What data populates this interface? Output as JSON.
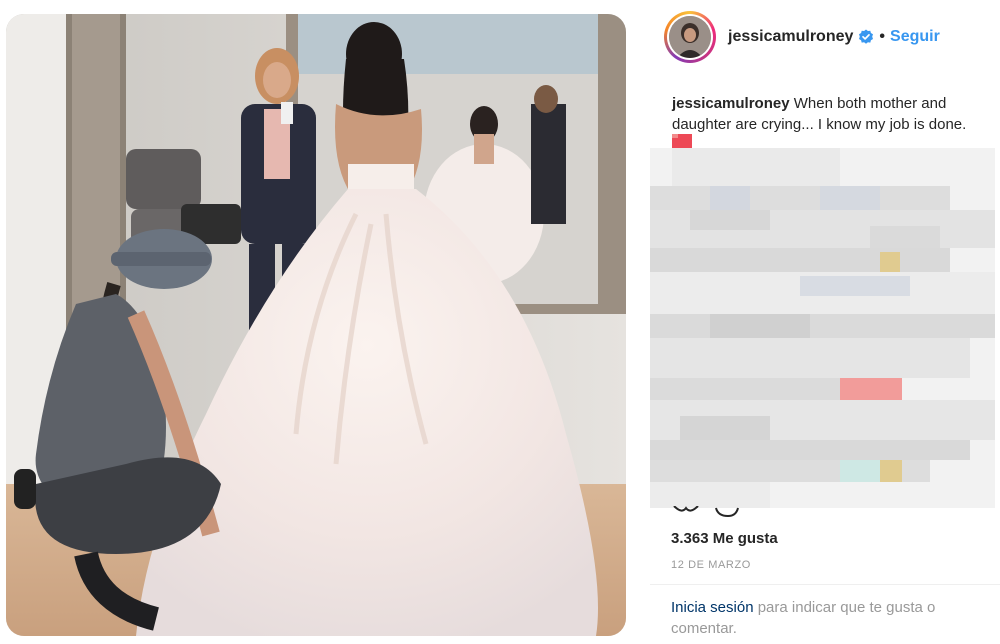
{
  "post": {
    "username": "jessicamulroney",
    "verified": true,
    "separator": "•",
    "follow_label": "Seguir",
    "caption_user": "jessicamulroney",
    "caption_text": "When both mother and daughter are crying... I know my job is done.",
    "likes": "3.363 Me gusta",
    "date": "12 DE MARZO",
    "login_link": "Inicia sesión",
    "login_rest": "para indicar que te gusta o comentar."
  },
  "colors": {
    "accent_blue": "#3897f0",
    "text_dark": "#262626",
    "text_muted": "#999999",
    "link_dark": "#003569",
    "heart_red": "#ed4956"
  },
  "icons": {
    "verified": "verified-badge-icon",
    "heart": "red-heart-emoji-icon",
    "like": "heart-outline-icon",
    "comment": "comment-bubble-icon"
  }
}
